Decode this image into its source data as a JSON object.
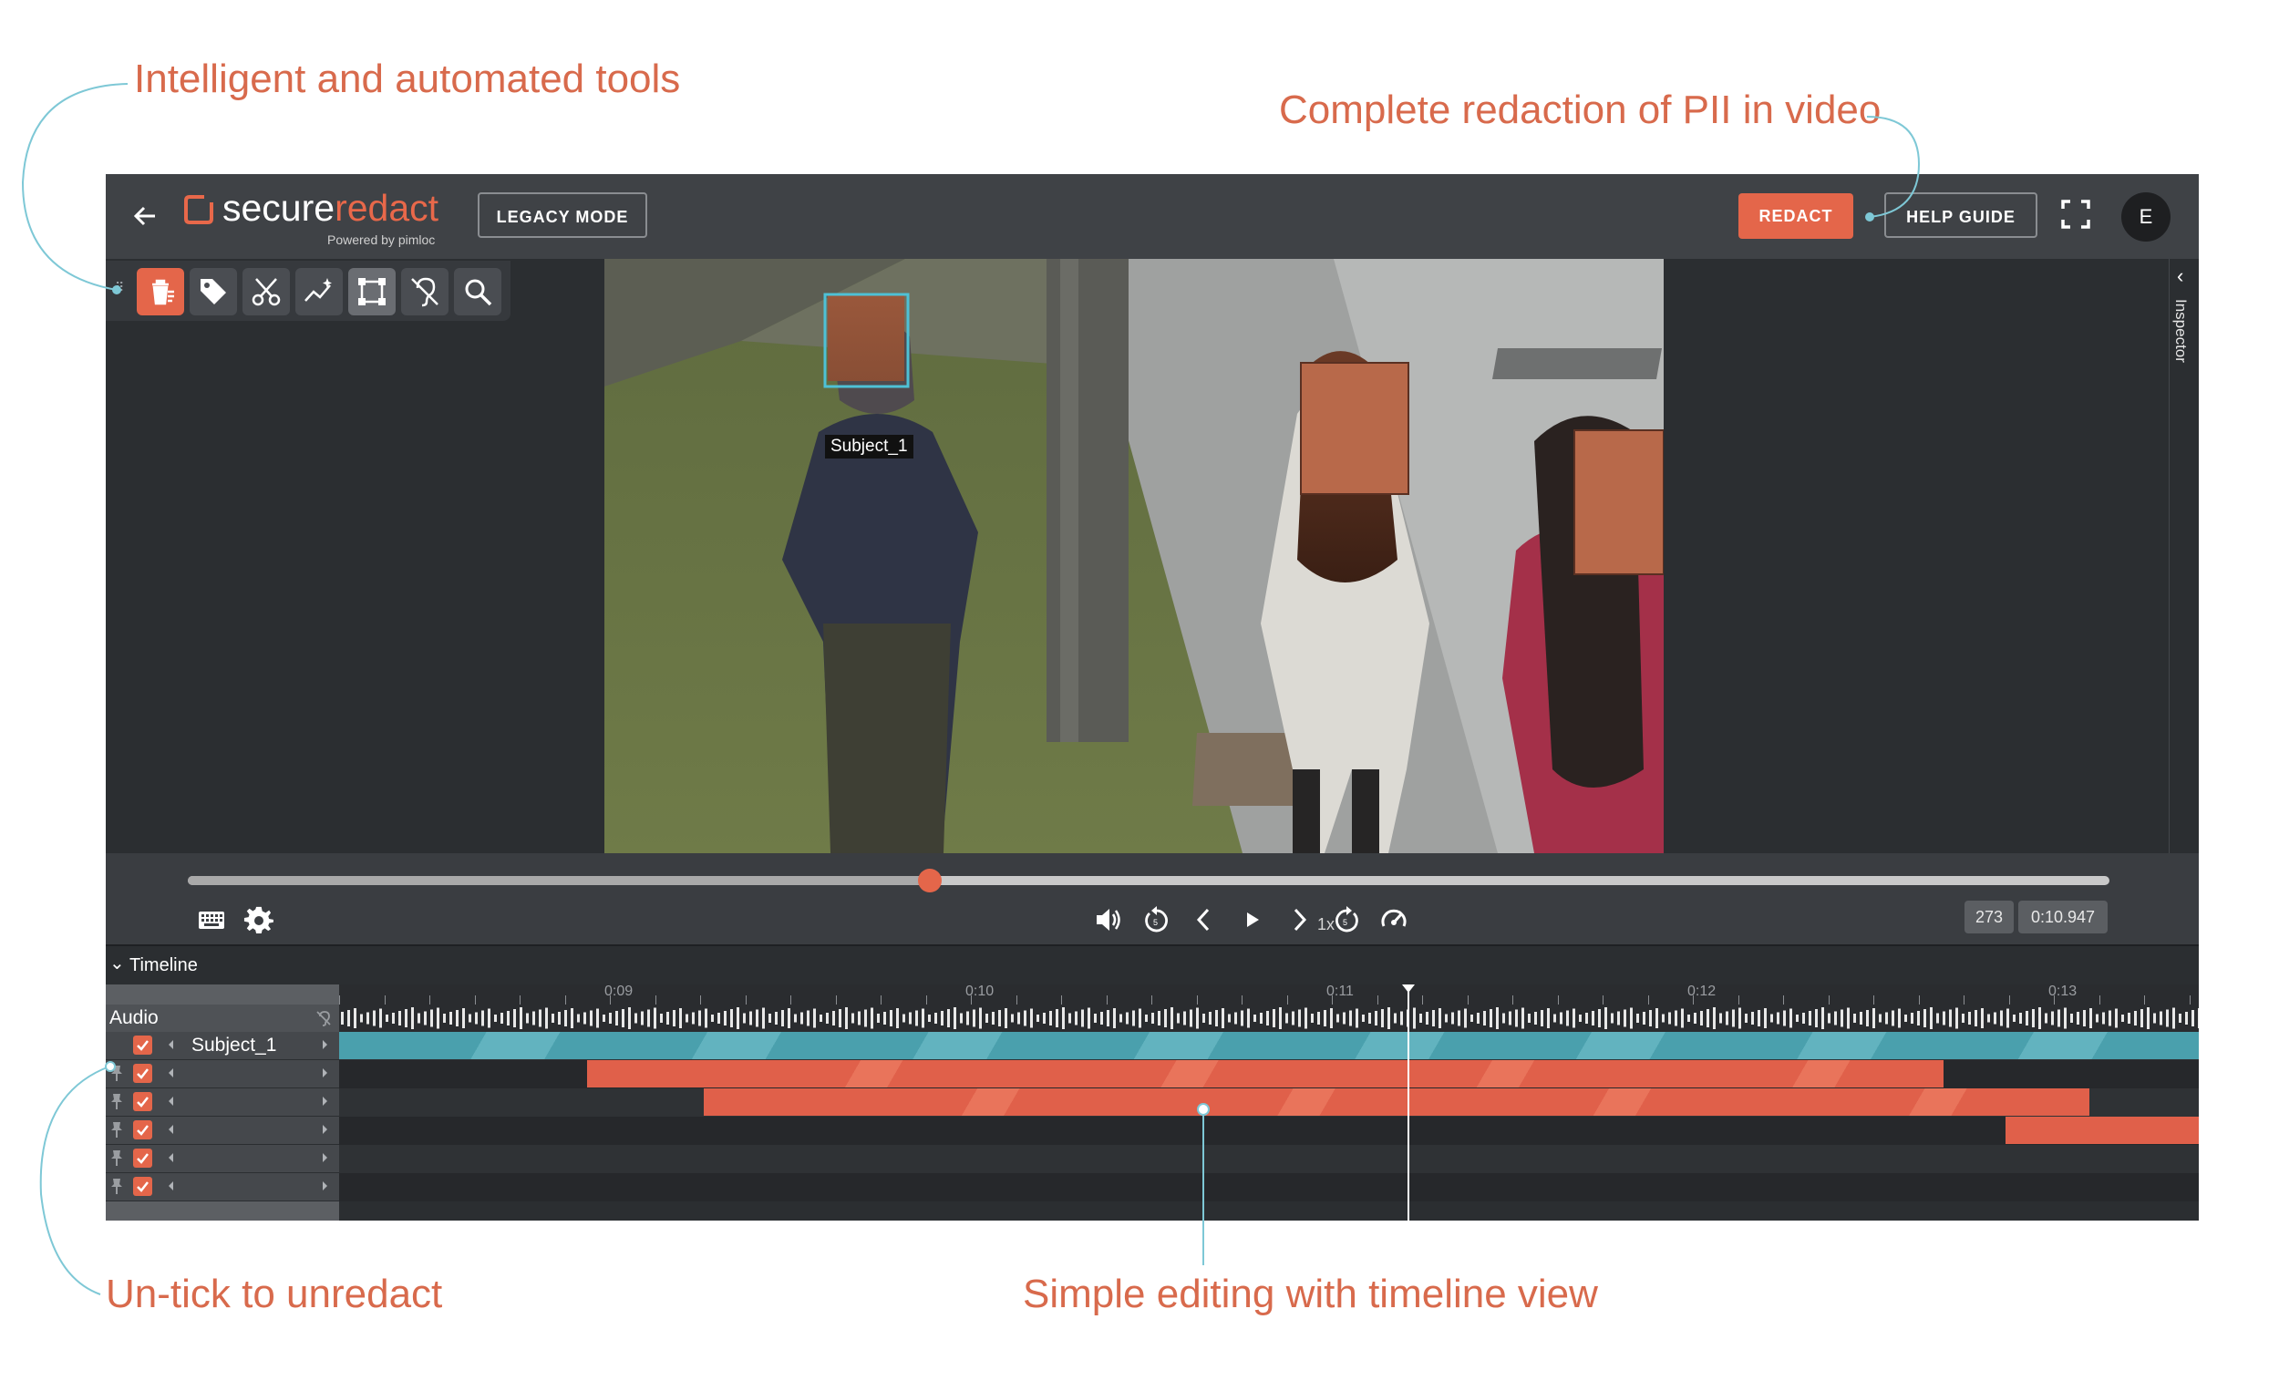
{
  "callouts": {
    "tools": "Intelligent and automated tools",
    "pii": "Complete redaction of PII in video",
    "untick": "Un-tick to unredact",
    "timeline": "Simple editing with timeline view"
  },
  "app": {
    "brand_prefix": "secure",
    "brand_accent": "redact",
    "brand_sub": "Powered by pimloc",
    "legacy_button": "LEGACY MODE",
    "redact_button": "REDACT",
    "help_button": "HELP GUIDE",
    "avatar_initial": "E",
    "inspector_label": "Inspector"
  },
  "toolbar": {
    "tools": [
      "redact-tool",
      "tag-tool",
      "cut-tool",
      "track-tool",
      "box-tool",
      "audio-tool",
      "search-tool"
    ]
  },
  "video": {
    "subject_label": "Subject_1"
  },
  "player": {
    "progress": 0.386,
    "speed": "1x",
    "frame": "273",
    "time": "0:10.947"
  },
  "timeline": {
    "header": "Timeline",
    "ticks": [
      "0:09",
      "0:10",
      "0:11",
      "0:12",
      "0:13"
    ],
    "audio_label": "Audio",
    "rows": [
      {
        "label": "Subject_1"
      },
      {
        "label": ""
      },
      {
        "label": ""
      },
      {
        "label": ""
      },
      {
        "label": ""
      },
      {
        "label": ""
      }
    ]
  },
  "colors": {
    "accent": "#e4664a",
    "teal": "#4aa0ad",
    "callout_line": "#7ec8d6",
    "callout_text": "#d86a4c"
  }
}
